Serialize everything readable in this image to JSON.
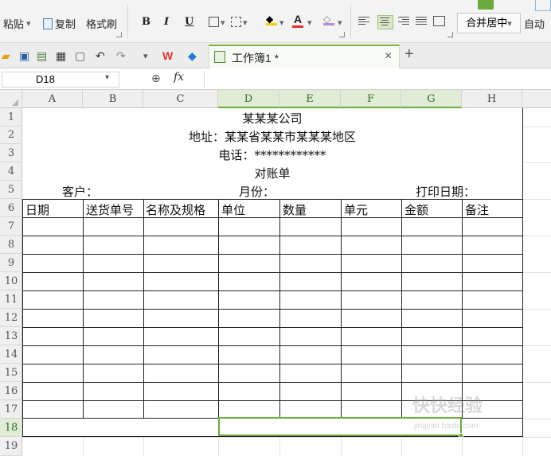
{
  "ribbon": {
    "paste": "粘贴",
    "copy": "复制",
    "format_painter": "格式刷",
    "bold": "B",
    "italic": "I",
    "underline": "U",
    "merge_center": "合并居中",
    "auto_wrap": "自动",
    "font_color_letter": "A"
  },
  "doc_tab": {
    "name": "工作簿1 *",
    "close": "×",
    "new": "+"
  },
  "formula_bar": {
    "cell_ref": "D18",
    "fx": "fx"
  },
  "columns": [
    "A",
    "B",
    "C",
    "D",
    "E",
    "F",
    "G",
    "H"
  ],
  "rows": [
    "1",
    "2",
    "3",
    "4",
    "5",
    "6",
    "7",
    "8",
    "9",
    "10",
    "11",
    "12",
    "13",
    "14",
    "15",
    "16",
    "17",
    "18",
    "19"
  ],
  "sheet": {
    "company": "某某某公司",
    "address": "地址：某某省某某市某某某地区",
    "phone": "电话：************",
    "title": "对账单",
    "customer": "客户：",
    "month": "月份：",
    "print_date": "打印日期：",
    "headers": [
      "日期",
      "送货单号",
      "名称及规格",
      "单位",
      "数量",
      "单元",
      "金额",
      "备注"
    ]
  },
  "watermark": {
    "text": "快快经验",
    "sub": "jingyan.baidu.com"
  },
  "colors": {
    "accent_green": "#6aaa3e",
    "wps_red": "#e0312f"
  }
}
